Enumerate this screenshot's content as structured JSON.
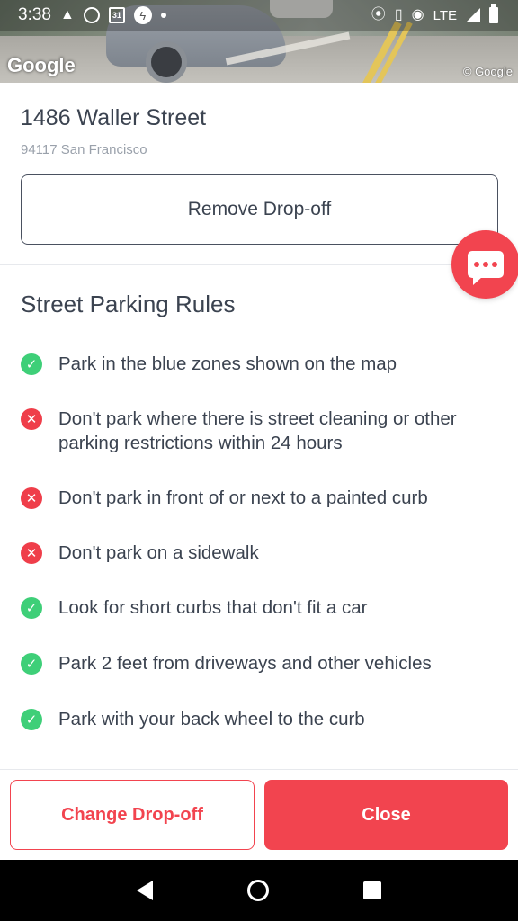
{
  "status_bar": {
    "time": "3:38",
    "calendar_day": "31",
    "network": "LTE",
    "icons": [
      "warning-icon",
      "circle-icon",
      "calendar-icon",
      "bolt-icon",
      "dot-icon",
      "location-icon",
      "vibrate-icon",
      "hotspot-icon",
      "signal-icon",
      "battery-icon"
    ]
  },
  "street_view": {
    "logo": "Google",
    "copyright": "© Google"
  },
  "address": {
    "street": "1486 Waller Street",
    "city": "94117 San Francisco",
    "remove_label": "Remove Drop-off"
  },
  "rules": {
    "title": "Street Parking Rules",
    "items": [
      {
        "status": "allowed",
        "text": "Park in the blue zones shown on the map"
      },
      {
        "status": "forbidden",
        "text": "Don't park where there is street cleaning or other parking restrictions within 24 hours"
      },
      {
        "status": "forbidden",
        "text": "Don't park in front of or next to a painted curb"
      },
      {
        "status": "forbidden",
        "text": "Don't park on a sidewalk"
      },
      {
        "status": "allowed",
        "text": "Look for short curbs that don't fit a car"
      },
      {
        "status": "allowed",
        "text": "Park 2 feet from driveways and other vehicles"
      },
      {
        "status": "allowed",
        "text": "Park with your back wheel to the curb"
      }
    ]
  },
  "actions": {
    "change_label": "Change Drop-off",
    "close_label": "Close"
  },
  "colors": {
    "accent": "#f2444f",
    "allowed": "#3ecf78",
    "forbidden": "#ef3e4a",
    "text": "#3b4350"
  }
}
